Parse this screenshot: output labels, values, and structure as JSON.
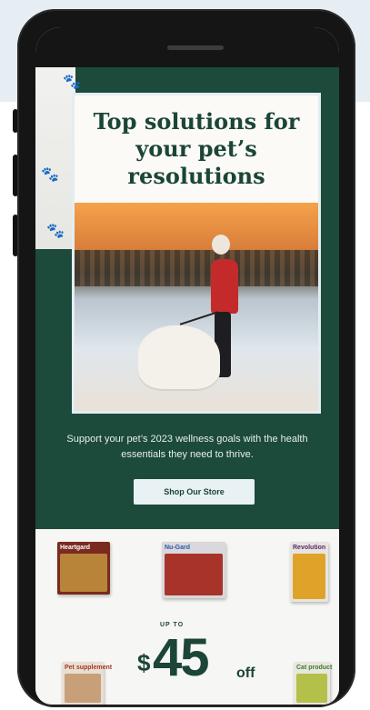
{
  "colors": {
    "brand_green": "#1c4a3b",
    "cta_bg": "#e8f1f4",
    "headline": "#1b4537",
    "backdrop": "#e6eef4"
  },
  "hero": {
    "headline": "Top solutions for your pet’s resolutions",
    "subcopy": "Support your pet’s 2023 wellness goals with the health essentials they need to thrive.",
    "cta_label": "Shop Our Store"
  },
  "products": [
    {
      "name": "Heartgard",
      "color": "#7a2a1e"
    },
    {
      "name": "Nu-Gard",
      "color": "#c9c8cc"
    },
    {
      "name": "Revolution",
      "color": "#e7e5e0"
    },
    {
      "name": "Pet supplement",
      "color": "#e8dfd2"
    },
    {
      "name": "Cat product",
      "color": "#e9e6dd"
    }
  ],
  "offer": {
    "prefix": "UP TO",
    "currency": "$",
    "amount": "45",
    "suffix": "off"
  },
  "icons": [
    "paw-print-icon"
  ]
}
